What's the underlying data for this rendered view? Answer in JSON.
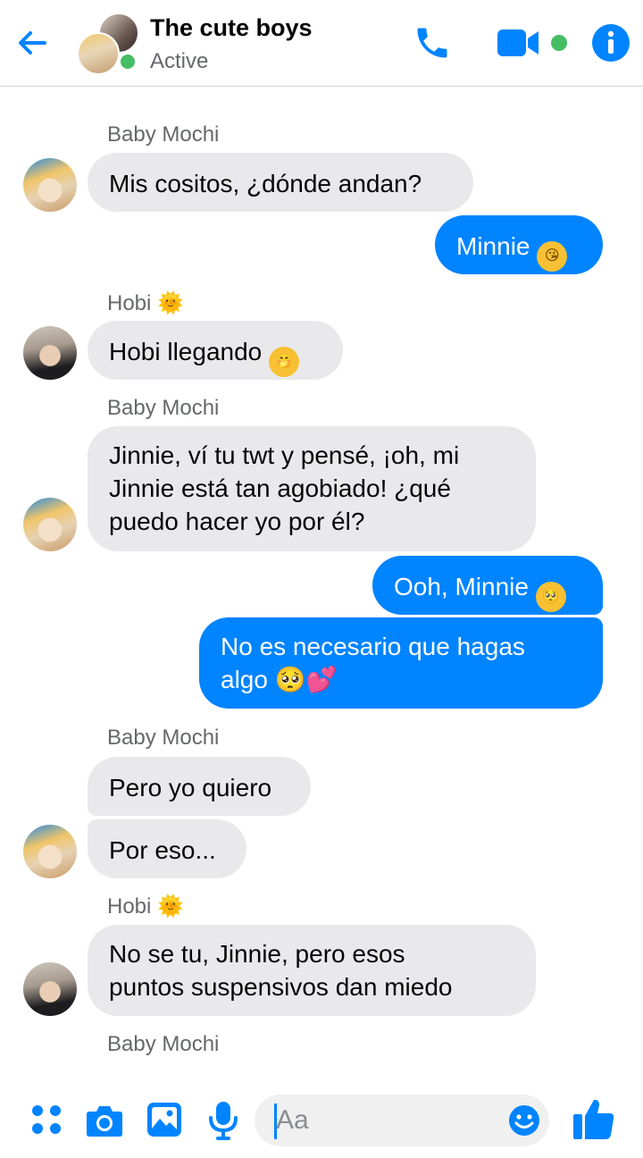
{
  "header": {
    "title": "The cute boys",
    "status": "Active",
    "accent": "#0084ff",
    "online_color": "#45bd62"
  },
  "messages": [
    {
      "sender": "Baby Mochi",
      "text": "Mis cositos, ¿dónde andan?",
      "direction": "incoming"
    },
    {
      "text": "Minnie",
      "emoji": "😘",
      "direction": "outgoing"
    },
    {
      "sender": "Hobi",
      "sender_emoji": "🌞",
      "text": "Hobi llegando",
      "emoji": "🤭",
      "direction": "incoming"
    },
    {
      "sender": "Baby Mochi",
      "lines": [
        "Jinnie, ví tu twt y pensé, ¡oh, mi",
        "Jinnie está tan agobiado! ¿qué",
        "puedo hacer yo por él?"
      ],
      "direction": "incoming"
    },
    {
      "text": "Ooh, Minnie",
      "emoji": "🥺",
      "direction": "outgoing"
    },
    {
      "lines": [
        "No es necesario que hagas",
        "algo"
      ],
      "emoji": "🥺💕",
      "direction": "outgoing"
    },
    {
      "sender": "Baby Mochi",
      "text": "Pero yo quiero",
      "direction": "incoming"
    },
    {
      "text": "Por eso...",
      "direction": "incoming"
    },
    {
      "sender": "Hobi",
      "sender_emoji": "🌞",
      "lines": [
        "No se tu, Jinnie, pero esos",
        "puntos suspensivos dan miedo"
      ],
      "direction": "incoming"
    },
    {
      "sender": "Baby Mochi",
      "direction": "incoming"
    }
  ],
  "composer": {
    "placeholder": "Aa"
  },
  "icons": {
    "back": "arrow-left-icon",
    "call": "phone-icon",
    "video": "video-camera-icon",
    "info": "info-icon",
    "menu": "four-dots-icon",
    "camera": "camera-icon",
    "gallery": "image-icon",
    "mic": "microphone-icon",
    "emoji": "smiley-icon",
    "like": "thumbs-up-icon"
  }
}
